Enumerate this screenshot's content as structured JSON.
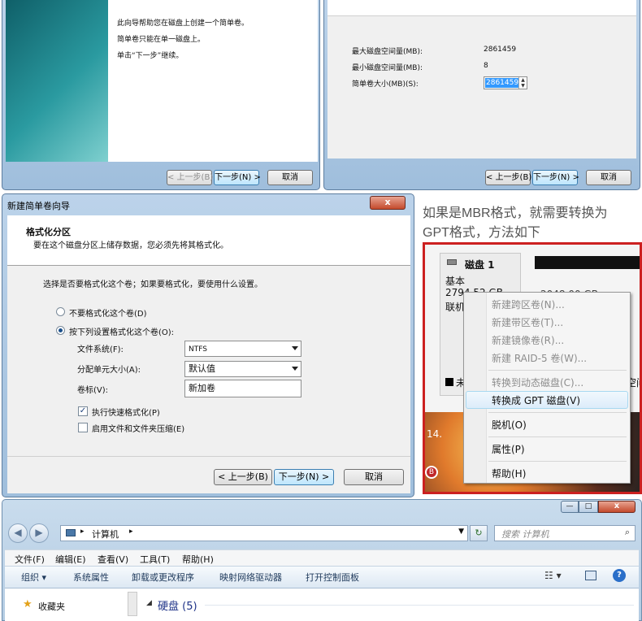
{
  "wizard_intro": {
    "lines": [
      "此向导帮助您在磁盘上创建一个简单卷。",
      "简单卷只能在单一磁盘上。",
      "单击“下一步”继续。"
    ],
    "back_label": "< 上一步(B)",
    "next_label": "下一步(N) >",
    "cancel_label": "取消"
  },
  "size_page": {
    "max_label": "最大磁盘空间量(MB):",
    "max_value": "2861459",
    "min_label": "最小磁盘空间量(MB):",
    "min_value": "8",
    "size_label": "简单卷大小(MB)(S):",
    "size_value": "2861459",
    "back_label": "< 上一步(B)",
    "next_label": "下一步(N) >",
    "cancel_label": "取消"
  },
  "format_dialog": {
    "title": "新建简单卷向导",
    "close": "x",
    "heading": "格式化分区",
    "subheading": "要在这个磁盘分区上储存数据，您必须先将其格式化。",
    "prompt": "选择是否要格式化这个卷；如果要格式化，要使用什么设置。",
    "option_no": "不要格式化这个卷(D)",
    "option_yes": "按下列设置格式化这个卷(O):",
    "fs_label": "文件系统(F):",
    "fs_value": "NTFS",
    "alloc_label": "分配单元大小(A):",
    "alloc_value": "默认值",
    "volume_label": "卷标(V):",
    "volume_value": "新加卷",
    "quick_format": "执行快速格式化(P)",
    "compress": "启用文件和文件夹压缩(E)",
    "back_label": "< 上一步(B)",
    "next_label": "下一步(N) >",
    "cancel_label": "取消"
  },
  "note": {
    "line1": "如果是MBR格式，就需要转换为",
    "line2": "GPT格式，方法如下"
  },
  "disk_panel": {
    "disk_name": "磁盘 1",
    "type": "基本",
    "size": "2794.52 GB",
    "status": "联机",
    "partition_size": "2048.00 GB",
    "unalloc_prefix": "未",
    "space_suffix": "空间",
    "bottom_label": "14.",
    "letter": "B"
  },
  "context_menu": {
    "items_disabled": [
      "新建跨区卷(N)...",
      "新建带区卷(T)...",
      "新建镜像卷(R)...",
      "新建 RAID-5 卷(W)..."
    ],
    "convert_dynamic": "转换到动态磁盘(C)...",
    "convert_gpt": "转换成 GPT 磁盘(V)",
    "offline": "脱机(O)",
    "properties": "属性(P)",
    "help": "帮助(H)"
  },
  "explorer": {
    "path": "计算机",
    "search_placeholder": "搜索 计算机",
    "menu": [
      "文件(F)",
      "编辑(E)",
      "查看(V)",
      "工具(T)",
      "帮助(H)"
    ],
    "toolbar": [
      "组织 ▾",
      "系统属性",
      "卸载或更改程序",
      "映射网络驱动器",
      "打开控制面板"
    ],
    "favorites": "收藏夹",
    "section": "硬盘 (5)"
  },
  "colors": {
    "accent": "#3399ff",
    "teal": "#1b7a80",
    "menu_border": "#cc2020"
  }
}
